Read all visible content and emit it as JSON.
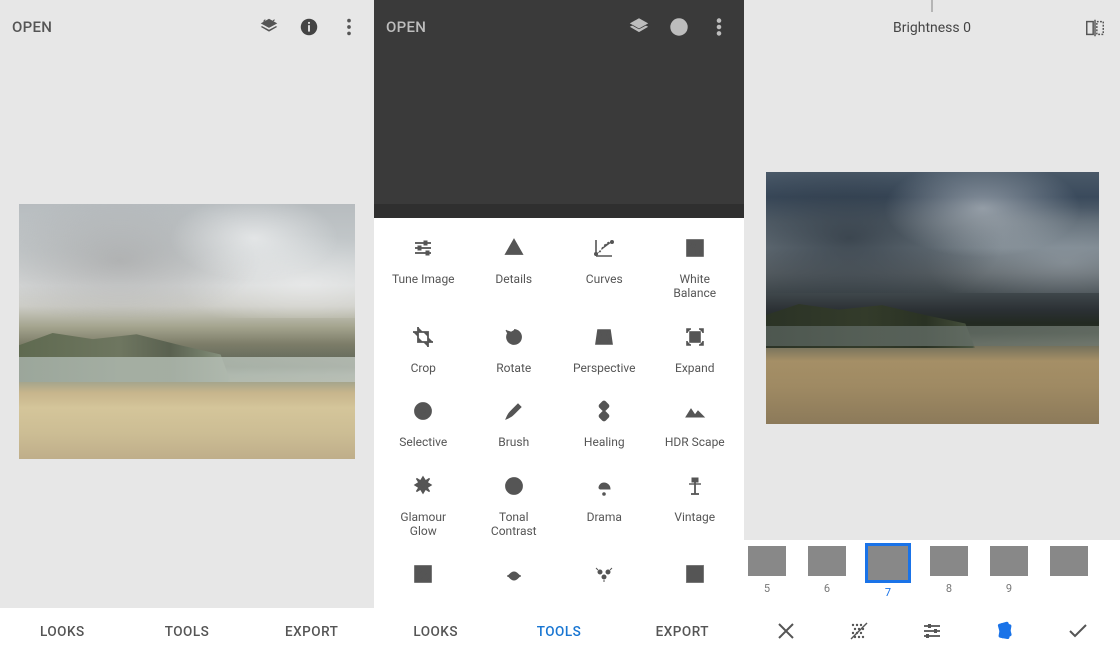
{
  "pane1": {
    "open_label": "OPEN",
    "nav": {
      "looks": "LOOKS",
      "tools": "TOOLS",
      "export": "EXPORT"
    }
  },
  "pane2": {
    "open_label": "OPEN",
    "nav": {
      "looks": "LOOKS",
      "tools": "TOOLS",
      "export": "EXPORT"
    },
    "active_nav": "tools",
    "tools": [
      {
        "id": "tune-image",
        "label": "Tune Image"
      },
      {
        "id": "details",
        "label": "Details"
      },
      {
        "id": "curves",
        "label": "Curves"
      },
      {
        "id": "white-balance",
        "label": "White\nBalance"
      },
      {
        "id": "crop",
        "label": "Crop"
      },
      {
        "id": "rotate",
        "label": "Rotate"
      },
      {
        "id": "perspective",
        "label": "Perspective"
      },
      {
        "id": "expand",
        "label": "Expand"
      },
      {
        "id": "selective",
        "label": "Selective"
      },
      {
        "id": "brush",
        "label": "Brush"
      },
      {
        "id": "healing",
        "label": "Healing"
      },
      {
        "id": "hdr-scape",
        "label": "HDR Scape"
      },
      {
        "id": "glamour-glow",
        "label": "Glamour\nGlow"
      },
      {
        "id": "tonal-contrast",
        "label": "Tonal\nContrast"
      },
      {
        "id": "drama",
        "label": "Drama"
      },
      {
        "id": "vintage",
        "label": "Vintage"
      }
    ],
    "tools_partial": [
      {
        "id": "grainy-film"
      },
      {
        "id": "retrolux"
      },
      {
        "id": "grunge"
      },
      {
        "id": "black-white"
      }
    ]
  },
  "pane3": {
    "header_label": "Brightness 0",
    "thumbs": [
      {
        "num": "5",
        "swatch": "sw5"
      },
      {
        "num": "6",
        "swatch": "sw6"
      },
      {
        "num": "7",
        "swatch": "sw7",
        "selected": true
      },
      {
        "num": "8",
        "swatch": "sw8"
      },
      {
        "num": "9",
        "swatch": "sw9"
      },
      {
        "num": "",
        "swatch": "sw10"
      }
    ]
  }
}
